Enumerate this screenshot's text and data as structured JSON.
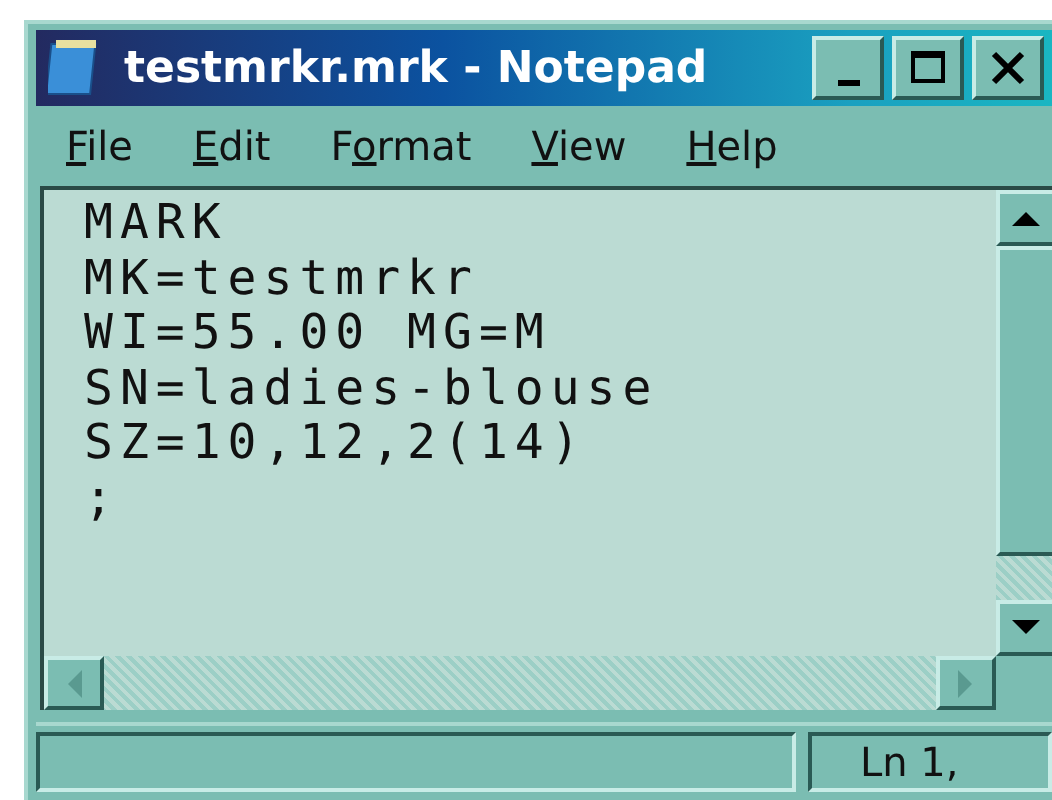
{
  "window": {
    "title": "testmrkr.mrk - Notepad"
  },
  "menu": [
    {
      "mnemonic": "F",
      "suffix": "ile"
    },
    {
      "mnemonic": "E",
      "suffix": "dit"
    },
    {
      "prefix": "F",
      "mnemonic": "o",
      "suffix": "rmat"
    },
    {
      "mnemonic": "V",
      "suffix": "iew"
    },
    {
      "mnemonic": "H",
      "suffix": "elp"
    }
  ],
  "editor": {
    "lines": [
      "MARK",
      "MK=testmrkr",
      "WI=55.00 MG=M",
      "SN=ladies-blouse",
      "SZ=10,12,2(14)",
      ";"
    ]
  },
  "status_bar": {
    "position": "Ln 1,"
  }
}
